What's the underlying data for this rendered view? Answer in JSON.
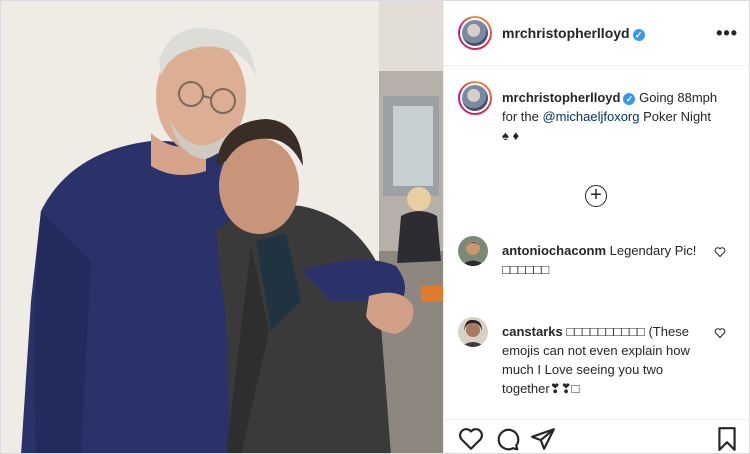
{
  "post": {
    "author": "mrchristopherlloyd",
    "verified_glyph": "✓",
    "more_label": "•••",
    "caption": {
      "author": "mrchristopherlloyd",
      "text_before": "Going 88mph for the ",
      "mention": "@michaeljfoxorg",
      "text_after": " Poker Night",
      "suits": "♠ ♦"
    },
    "load_more_label": "+",
    "comments": [
      {
        "author": "antoniochaconm",
        "text": "Legendary Pic! □□□□□□"
      },
      {
        "author": "canstarks",
        "text": "□□□□□□□□□□ (These emojis can not even explain how much I Love seeing you two together❣❣□"
      }
    ]
  },
  "icons": {
    "more": "more-options-icon",
    "verified": "verified-badge-icon",
    "load_more": "plus-circle-icon",
    "comment_like": "heart-outline-icon",
    "like": "heart-icon",
    "comment": "comment-bubble-icon",
    "share": "paper-plane-icon",
    "save": "bookmark-icon"
  },
  "colors": {
    "text": "#262626",
    "mention": "#00376b",
    "verified": "#3897f0",
    "border": "#efefef"
  }
}
